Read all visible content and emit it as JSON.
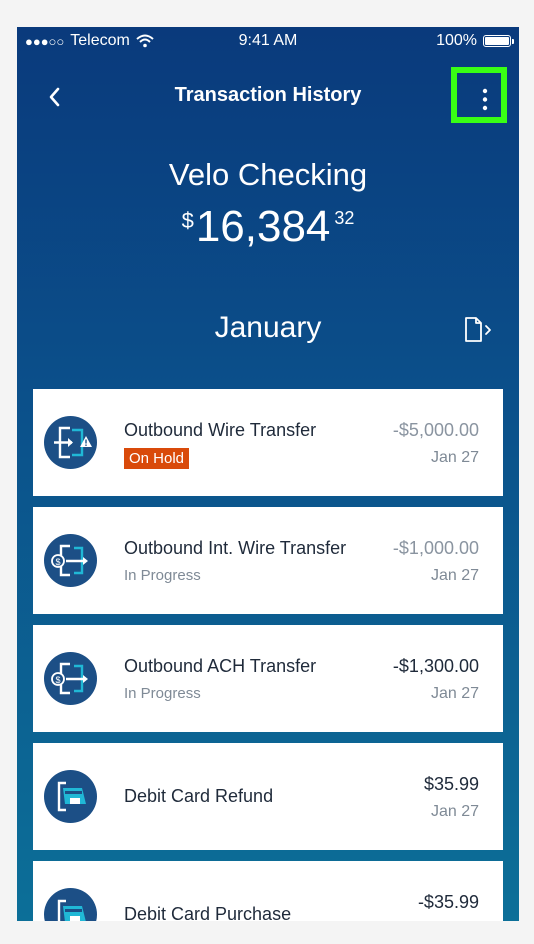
{
  "status_bar": {
    "carrier": "Telecom",
    "signal_dots": "●●●○○",
    "time": "9:41 AM",
    "battery": "100%"
  },
  "navbar": {
    "title": "Transaction History",
    "back_icon": "chevron-left-icon",
    "more_icon": "vertical-ellipsis-icon"
  },
  "account": {
    "name": "Velo Checking",
    "currency_symbol": "$",
    "balance_whole": "16,384",
    "balance_cents": "32"
  },
  "month": {
    "label": "January",
    "export_icon": "document-chevron-icon"
  },
  "transactions": [
    {
      "title": "Outbound Wire Transfer",
      "status": "On Hold",
      "status_type": "badge",
      "amount": "-$5,000.00",
      "amount_style": "muted",
      "date": "Jan 27",
      "icon": "wire-transfer-warning-icon"
    },
    {
      "title": "Outbound Int. Wire Transfer",
      "status": "In Progress",
      "status_type": "text",
      "amount": "-$1,000.00",
      "amount_style": "muted",
      "date": "Jan 27",
      "icon": "money-transfer-out-icon"
    },
    {
      "title": "Outbound ACH Transfer",
      "status": "In Progress",
      "status_type": "text",
      "amount": "-$1,300.00",
      "amount_style": "dark",
      "date": "Jan 27",
      "icon": "money-transfer-out-icon"
    },
    {
      "title": "Debit Card Refund",
      "status": "",
      "status_type": "none",
      "amount": "$35.99",
      "amount_style": "dark",
      "date": "Jan 27",
      "icon": "debit-card-icon"
    },
    {
      "title": "Debit Card Purchase",
      "status": "",
      "status_type": "none",
      "amount": "-$35.99",
      "amount_style": "dark",
      "date": "",
      "icon": "debit-card-icon"
    }
  ],
  "colors": {
    "background_top": "#0a3a7c",
    "background_bottom": "#0c6f98",
    "badge_hold": "#d94a0a",
    "icon_circle": "#1c4f86",
    "icon_accent": "#20b8d6",
    "highlight": "#39ff14"
  }
}
